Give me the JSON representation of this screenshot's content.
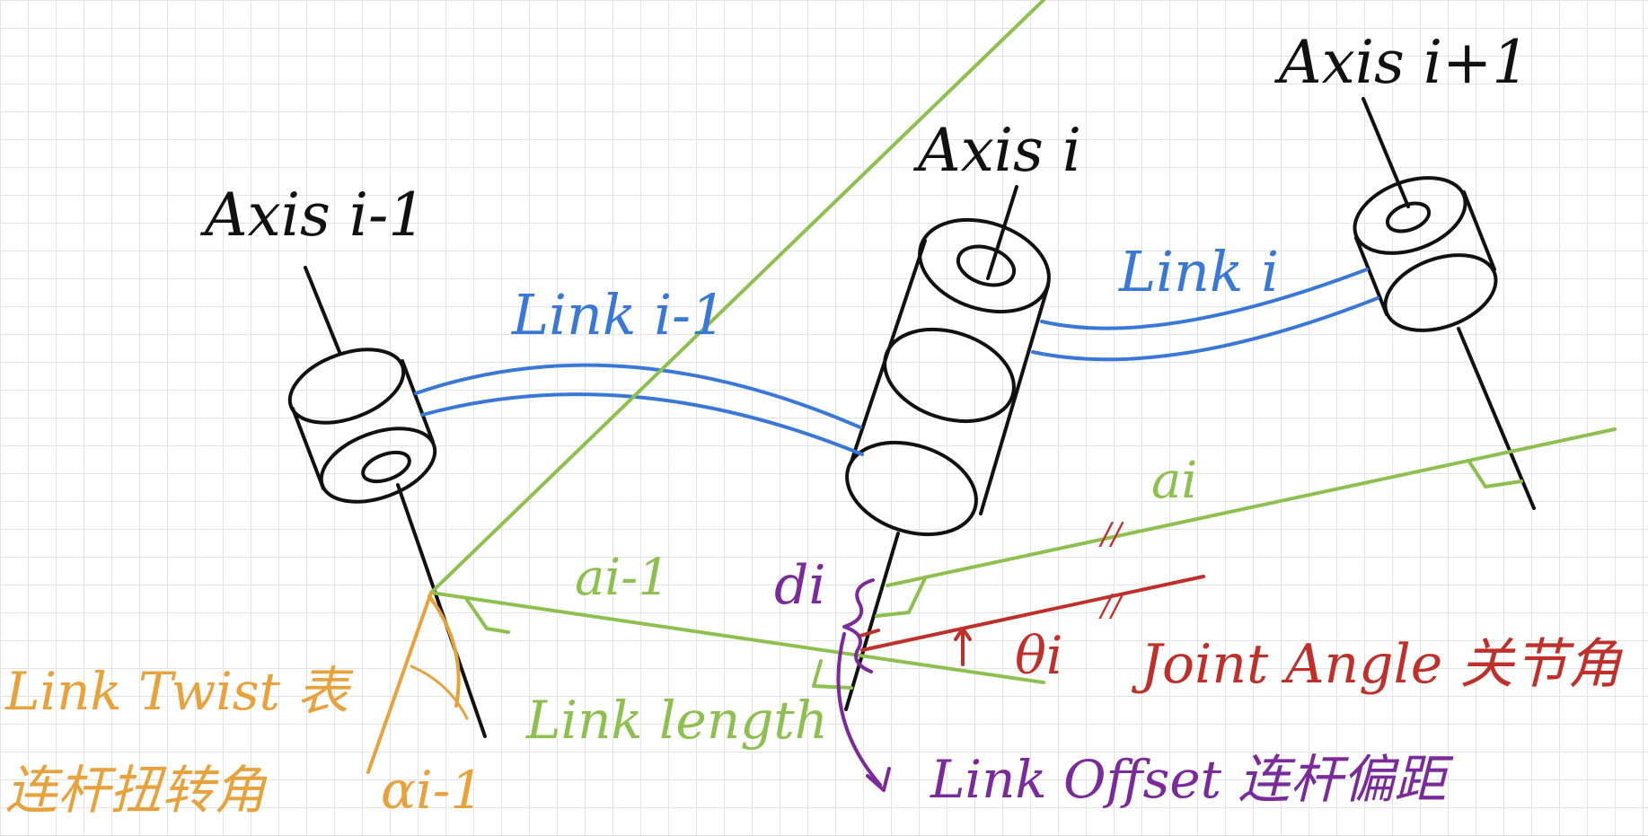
{
  "colors": {
    "black": "#111111",
    "blue": "#3a78d8",
    "green": "#8dc04f",
    "orange": "#e8a23c",
    "red": "#c0302b",
    "purple": "#7b2a9c"
  },
  "labels": {
    "axis_prev": "Axis i-1",
    "axis_cur": "Axis i",
    "axis_next": "Axis i+1",
    "link_prev": "Link i-1",
    "link_cur": "Link i",
    "a_prev": "ai-1",
    "a_cur": "ai",
    "d_i": "di",
    "theta_i": "θi",
    "link_length": "Link length",
    "link_twist": "Link Twist 表",
    "link_twist_cn": "连杆扭转角",
    "alpha_prev": "αi-1",
    "joint_angle": "Joint Angle 关节角",
    "link_offset": "Link Offset 连杆偏距",
    "parallel_mark": "//"
  }
}
